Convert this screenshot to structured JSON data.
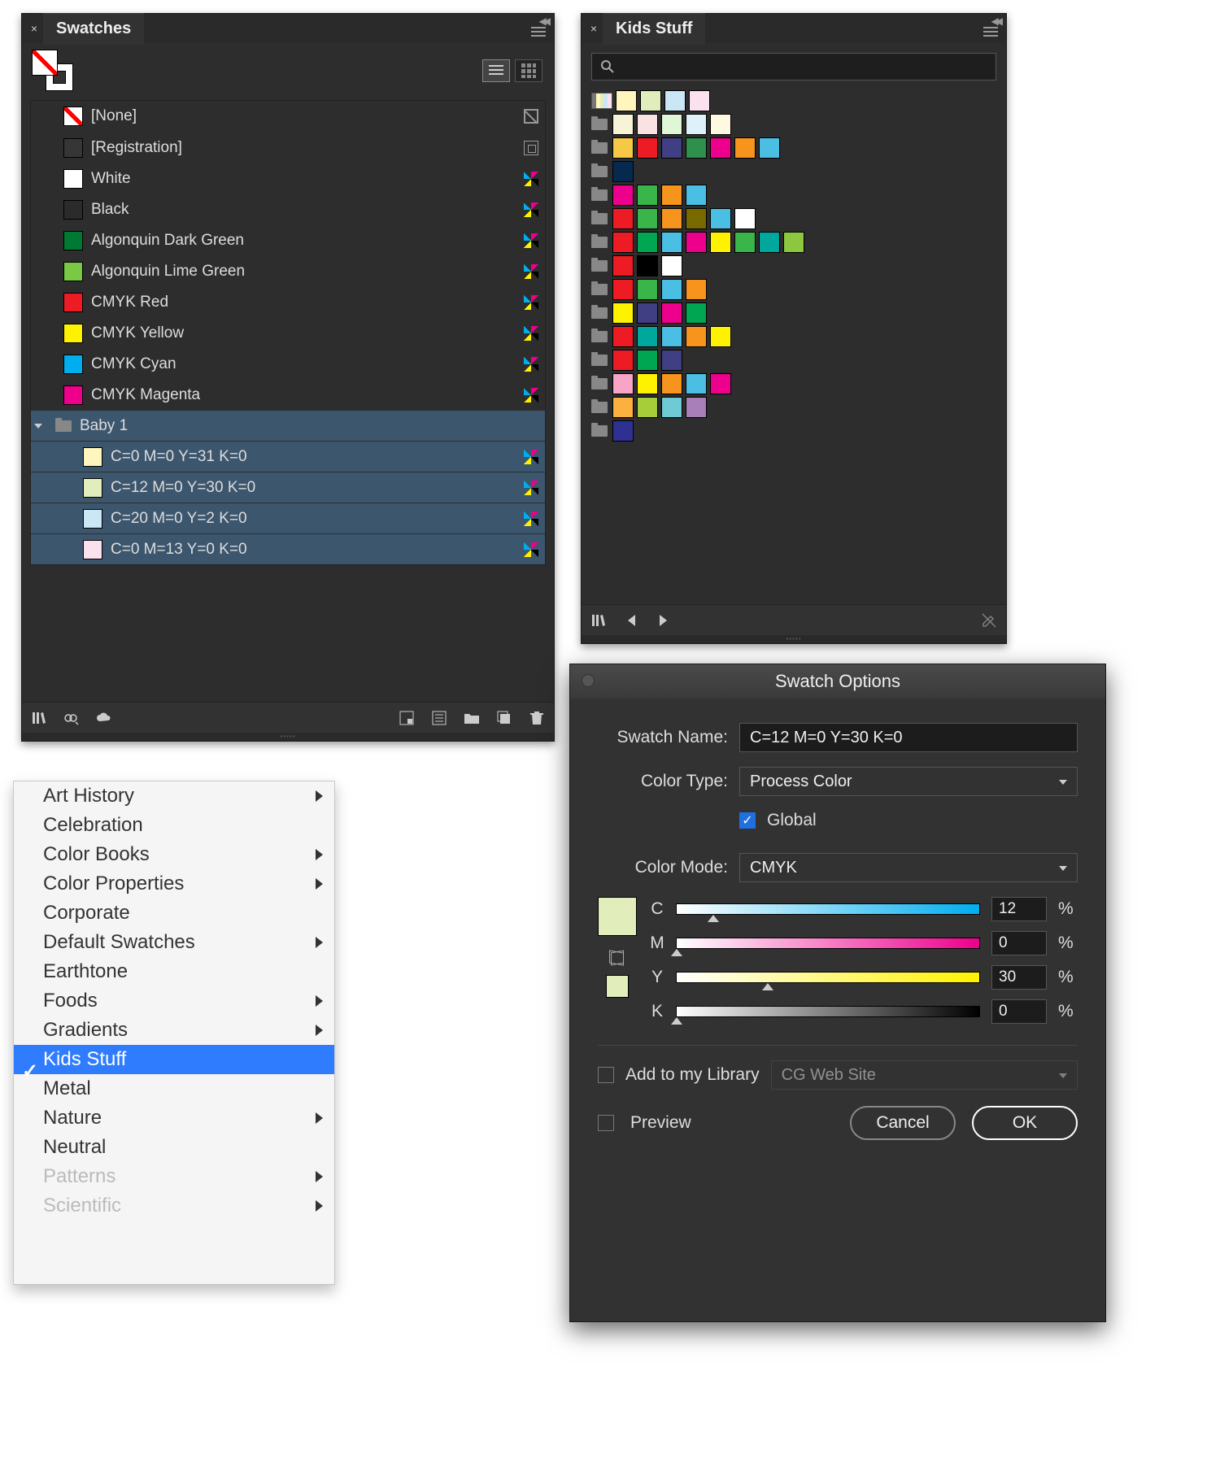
{
  "swatches_panel": {
    "title": "Swatches",
    "items": [
      {
        "label": "[None]",
        "type": "none"
      },
      {
        "label": "[Registration]",
        "type": "reg"
      },
      {
        "label": "White",
        "color": "#ffffff"
      },
      {
        "label": "Black",
        "color": "#2b2b2b"
      },
      {
        "label": "Algonquin Dark Green",
        "color": "#007a33"
      },
      {
        "label": "Algonquin Lime Green",
        "color": "#7ac943"
      },
      {
        "label": "CMYK Red",
        "color": "#ed1c24"
      },
      {
        "label": "CMYK Yellow",
        "color": "#fff200"
      },
      {
        "label": "CMYK Cyan",
        "color": "#00aeef"
      },
      {
        "label": "CMYK Magenta",
        "color": "#ec008c"
      }
    ],
    "group": {
      "name": "Baby 1",
      "swatches": [
        {
          "label": "C=0 M=0 Y=31 K=0",
          "color": "#fff6bd"
        },
        {
          "label": "C=12 M=0 Y=30 K=0",
          "color": "#e1eebc"
        },
        {
          "label": "C=20 M=0 Y=2 K=0",
          "color": "#cbe7f6"
        },
        {
          "label": "C=0 M=13 Y=0 K=0",
          "color": "#fbe1ee"
        }
      ]
    }
  },
  "kids_panel": {
    "title": "Kids Stuff",
    "search_placeholder": "",
    "lead": [
      "#777",
      "#fff6bd",
      "#e1eebc",
      "#cbe7f6",
      "#fbe1ee"
    ],
    "rows": [
      [
        "#f7f3d6",
        "#f9e2e2",
        "#dff7d6",
        "#def1fb",
        "#fff9e1"
      ],
      [
        "#f5c945",
        "#ed1c24",
        "#403f84",
        "#2f8f4c",
        "#ec008c",
        "#f7941d",
        "#4abfe3"
      ],
      [
        "#062a4f"
      ],
      [
        "#ec008c",
        "#39b54a",
        "#f7941d",
        "#4abfe3"
      ],
      [
        "#ed1c24",
        "#39b54a",
        "#f7941d",
        "#796a00",
        "#4abfe3",
        "#ffffff"
      ],
      [
        "#ed1c24",
        "#00a651",
        "#4abfe3",
        "#ec008c",
        "#fff200",
        "#39b54a",
        "#00a79d",
        "#8dc63f"
      ],
      [
        "#ed1c24",
        "#000000",
        "#ffffff"
      ],
      [
        "#ed1c24",
        "#39b54a",
        "#4abfe3",
        "#f7941d"
      ],
      [
        "#fff200",
        "#403f84",
        "#ec008c",
        "#00a651"
      ],
      [
        "#ed1c24",
        "#00a79d",
        "#4abfe3",
        "#f7941d",
        "#fff200"
      ],
      [
        "#ed1c24",
        "#00a651",
        "#403f84"
      ],
      [
        "#f7a4c6",
        "#fff200",
        "#f7941d",
        "#4abfe3",
        "#ec008c"
      ],
      [
        "#fbb040",
        "#a6ce39",
        "#6ecbd4",
        "#a97fb9"
      ],
      [
        "#2e3192"
      ]
    ]
  },
  "menu": {
    "items": [
      {
        "label": "Art History",
        "sub": true
      },
      {
        "label": "Celebration"
      },
      {
        "label": "Color Books",
        "sub": true
      },
      {
        "label": "Color Properties",
        "sub": true
      },
      {
        "label": "Corporate"
      },
      {
        "label": "Default Swatches",
        "sub": true
      },
      {
        "label": "Earthtone"
      },
      {
        "label": "Foods",
        "sub": true
      },
      {
        "label": "Gradients",
        "sub": true
      },
      {
        "label": "Kids Stuff",
        "checked": true,
        "hover": true
      },
      {
        "label": "Metal"
      },
      {
        "label": "Nature",
        "sub": true
      },
      {
        "label": "Neutral"
      },
      {
        "label": "Patterns",
        "sub": true,
        "faded": true
      },
      {
        "label": "Scientific",
        "sub": true,
        "faded": true
      }
    ]
  },
  "dialog": {
    "title": "Swatch Options",
    "name_lbl": "Swatch Name:",
    "name_val": "C=12 M=0 Y=30 K=0",
    "type_lbl": "Color Type:",
    "type_val": "Process Color",
    "global_lbl": "Global",
    "mode_lbl": "Color Mode:",
    "mode_val": "CMYK",
    "c_lbl": "C",
    "c_val": "12",
    "m_lbl": "M",
    "m_val": "0",
    "y_lbl": "Y",
    "y_val": "30",
    "k_lbl": "K",
    "k_val": "0",
    "lib_lbl": "Add to my Library",
    "lib_val": "CG Web Site",
    "preview_lbl": "Preview",
    "cancel_lbl": "Cancel",
    "ok_lbl": "OK",
    "preview_color": "#e1eebc"
  }
}
